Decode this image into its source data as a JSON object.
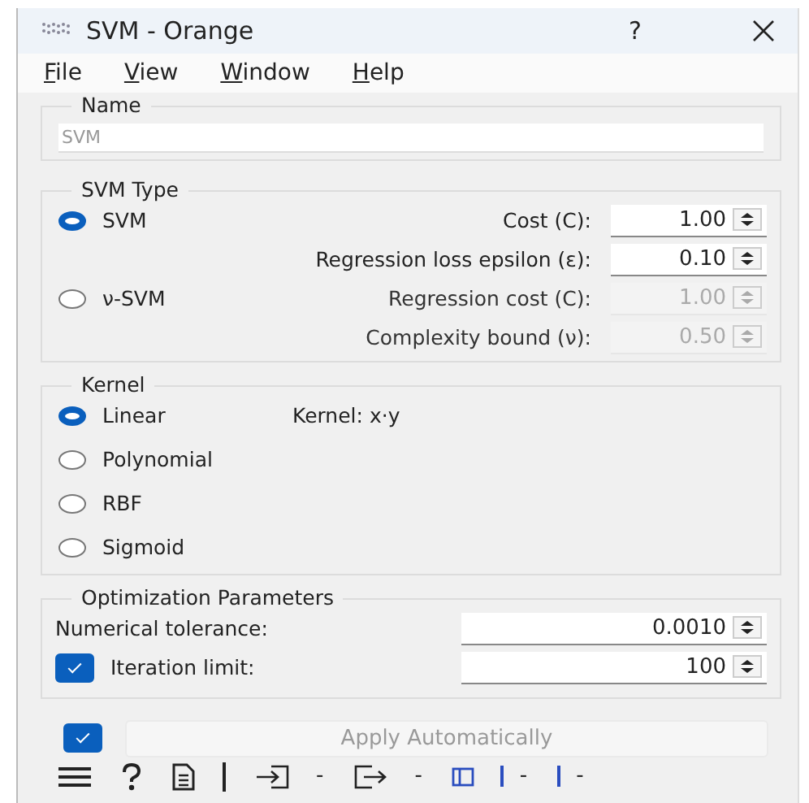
{
  "window": {
    "title": "SVM - Orange",
    "help": "?"
  },
  "menu": [
    "File",
    "View",
    "Window",
    "Help"
  ],
  "name_box": {
    "title": "Name",
    "placeholder": "SVM"
  },
  "svm_type": {
    "title": "SVM Type",
    "options": [
      {
        "label": "SVM",
        "selected": true
      },
      {
        "label": "ν-SVM",
        "selected": false
      }
    ],
    "parameters": [
      {
        "label": "Cost (C):",
        "value": "1.00",
        "disabled": false
      },
      {
        "label": "Regression loss epsilon (ε):",
        "value": "0.10",
        "disabled": false
      },
      {
        "label": "Regression cost (C):",
        "value": "1.00",
        "disabled": true
      },
      {
        "label": "Complexity bound (ν):",
        "value": "0.50",
        "disabled": true
      }
    ]
  },
  "kernel": {
    "title": "Kernel",
    "formula": "Kernel: x⋅y",
    "options": [
      {
        "label": "Linear",
        "selected": true
      },
      {
        "label": "Polynomial",
        "selected": false
      },
      {
        "label": "RBF",
        "selected": false
      },
      {
        "label": "Sigmoid",
        "selected": false
      }
    ]
  },
  "optimization": {
    "title": "Optimization Parameters",
    "parameters": [
      {
        "kind": "label",
        "label": "Numerical tolerance:",
        "value": "0.0010"
      },
      {
        "kind": "checkbox",
        "label": "Iteration limit:",
        "checked": true,
        "value": "100"
      }
    ]
  },
  "apply": {
    "checked": true,
    "label": "Apply Automatically",
    "disabled": true
  },
  "status_bar": {
    "input_count": "-",
    "output_count": "-",
    "extra": [
      "-",
      "-"
    ]
  }
}
